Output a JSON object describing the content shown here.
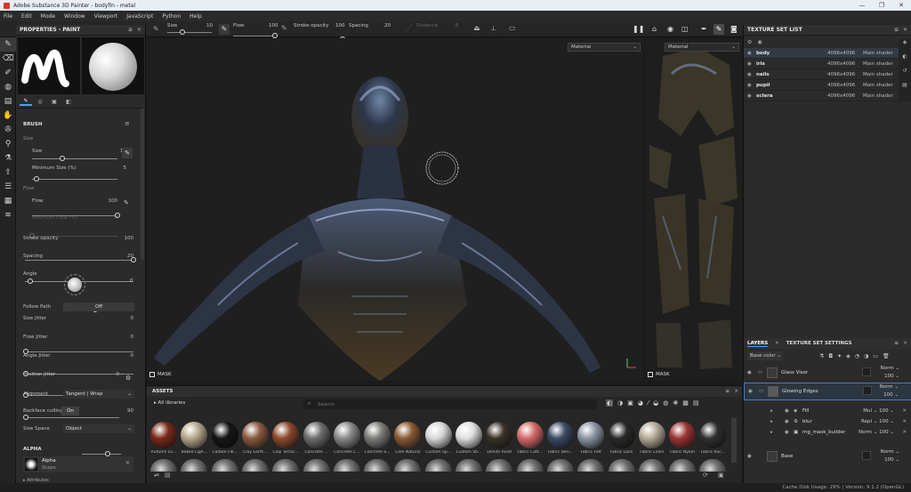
{
  "window": {
    "title": "Adobe Substance 3D Painter - bodyfin - metal",
    "controls": [
      "—",
      "❐",
      "✕"
    ]
  },
  "menu": [
    "File",
    "Edit",
    "Mode",
    "Window",
    "Viewport",
    "JavaScript",
    "Python",
    "Help"
  ],
  "toolbar": {
    "size_label": "Size",
    "size_value": "10",
    "flow_label": "Flow",
    "flow_value": "100",
    "stroke_opacity_label": "Stroke opacity",
    "stroke_opacity_value": "100",
    "spacing_label": "Spacing",
    "spacing_value": "20",
    "distance_label": "Distance",
    "distance_value": "6"
  },
  "properties": {
    "title": "PROPERTIES - PAINT",
    "brush_header": "BRUSH",
    "size": {
      "section": "Size",
      "label": "Size",
      "value": "10",
      "fraction": 0.35
    },
    "min_size": {
      "label": "Minimum Size (%)",
      "value": "5",
      "fraction": 0.05
    },
    "flow_section": "Flow",
    "flow": {
      "label": "Flow",
      "value": "100",
      "fraction": 1.0
    },
    "min_flow": {
      "label": "Minimum Flow (%)",
      "value": "0",
      "fraction": 0.0
    },
    "stroke_opacity": {
      "label": "Stroke opacity",
      "value": "100",
      "fraction": 1.0
    },
    "spacing": {
      "label": "Spacing",
      "value": "20",
      "fraction": 0.05
    },
    "angle": {
      "label": "Angle",
      "value": "0"
    },
    "follow_path": {
      "label": "Follow Path",
      "value": "Off"
    },
    "size_jitter": {
      "label": "Size Jitter",
      "value": "0"
    },
    "flow_jitter": {
      "label": "Flow Jitter",
      "value": "0"
    },
    "angle_jitter": {
      "label": "Angle Jitter",
      "value": "0"
    },
    "position_jitter": {
      "label": "Position Jitter",
      "value": "0"
    },
    "alignment": {
      "label": "Alignment",
      "value": "Tangent | Wrap"
    },
    "backface": {
      "label": "Backface culling",
      "toggle": "On",
      "value": "90"
    },
    "size_space": {
      "label": "Size Space",
      "value": "Object"
    },
    "alpha_header": "ALPHA",
    "alpha_name": "Alpha",
    "alpha_sub": "Shape",
    "attributes": "Attributes"
  },
  "viewport": {
    "dropdown": "Material",
    "mask_label": "MASK",
    "uv_dropdown": "Material",
    "uv_mask_label": "MASK"
  },
  "texture_set": {
    "title": "TEXTURE SET LIST",
    "rows": [
      {
        "name": "body",
        "res": "4096x4096",
        "shader": "Main shader"
      },
      {
        "name": "iris",
        "res": "4096x4096",
        "shader": "Main shader"
      },
      {
        "name": "nails",
        "res": "4096x4096",
        "shader": "Main shader"
      },
      {
        "name": "pupil",
        "res": "4096x4096",
        "shader": "Main shader"
      },
      {
        "name": "sclera",
        "res": "4096x4096",
        "shader": "Main shader"
      }
    ]
  },
  "layers": {
    "tab1": "LAYERS",
    "tab2": "TEXTURE SET SETTINGS",
    "channel": "Base color",
    "items": [
      {
        "name": "Glass Visor",
        "blend": "Norm",
        "opacity": "100"
      },
      {
        "name": "Glowing Edges",
        "blend": "Norm",
        "opacity": "100"
      },
      {
        "name": "Fill",
        "blend": "Mul",
        "opacity": "100"
      },
      {
        "name": "blur",
        "blend": "Repl",
        "opacity": "100"
      },
      {
        "name": "mg_mask_builder",
        "blend": "Norm",
        "opacity": "100"
      },
      {
        "name": "Base",
        "blend": "Norm",
        "opacity": "100"
      }
    ]
  },
  "assets": {
    "title": "ASSETS",
    "library": "All libraries",
    "search_placeholder": "Search",
    "materials": [
      {
        "name": "Autumn Le...",
        "color": "#7a2a1a"
      },
      {
        "name": "Baked Ligh...",
        "color": "#b8a88c"
      },
      {
        "name": "Carbon Fib...",
        "color": "#151515"
      },
      {
        "name": "Clay Earth...",
        "color": "#8a5a40"
      },
      {
        "name": "Clay Terrac...",
        "color": "#8c4a2e"
      },
      {
        "name": "Concrete ...",
        "color": "#6e6e6e"
      },
      {
        "name": "Concrete C...",
        "color": "#8a8a8a"
      },
      {
        "name": "Concrete S...",
        "color": "#7c7c7a"
      },
      {
        "name": "Cork Natural",
        "color": "#8a5a35"
      },
      {
        "name": "Custom Sp...",
        "color": "#d8d8d8"
      },
      {
        "name": "Custom Sti...",
        "color": "#e0e0e0"
      },
      {
        "name": "Denim Rivet",
        "color": "#3a3228"
      },
      {
        "name": "Fabric Cott...",
        "color": "#d46a6a"
      },
      {
        "name": "Fabric Den...",
        "color": "#3c4a66"
      },
      {
        "name": "Fabric Felt",
        "color": "#8c96a4"
      },
      {
        "name": "Fabric Lace",
        "color": "#2a2a2a"
      },
      {
        "name": "Fabric Linen",
        "color": "#b4aa98"
      },
      {
        "name": "Fabric Nylon",
        "color": "#9a3434"
      },
      {
        "name": "Fabric Ruc...",
        "color": "#303030"
      }
    ]
  },
  "status": "Cache Disk Usage:  29% | Version: 9.1.2 (OpenGL)"
}
